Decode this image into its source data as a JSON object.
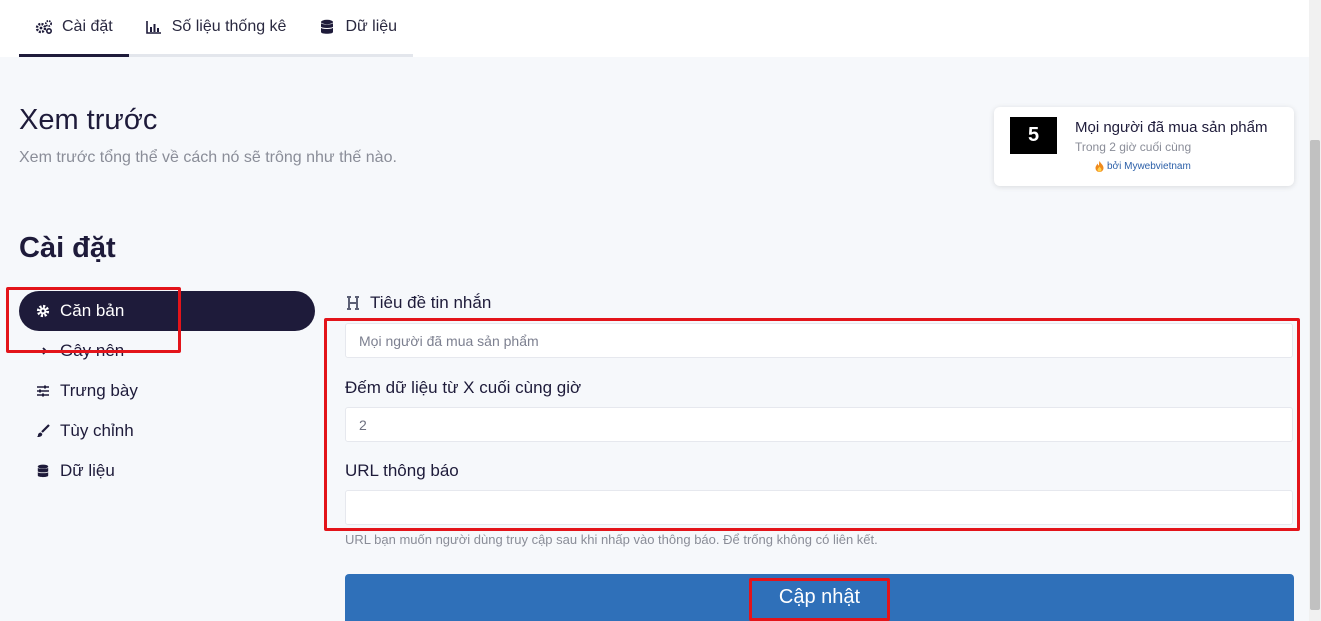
{
  "tabs": [
    {
      "label": "Cài đặt",
      "icon": "gears-icon",
      "active": true
    },
    {
      "label": "Số liệu thống kê",
      "icon": "bar-chart-icon"
    },
    {
      "label": "Dữ liệu",
      "icon": "database-icon"
    }
  ],
  "preview": {
    "title": "Xem trước",
    "description": "Xem trước tổng thể về cách nó sẽ trông như thế nào."
  },
  "notification": {
    "count": "5",
    "title": "Mọi người đã mua sản phẩm",
    "subtitle": "Trong 2 giờ cuối cùng",
    "by": "bởi Mywebvietnam",
    "by_icon": "fire-icon"
  },
  "settings": {
    "title": "Cài đặt",
    "menu": [
      {
        "label": "Căn bản",
        "icon": "gear-icon",
        "active": true
      },
      {
        "label": "Gây nên",
        "icon": "trigger-icon"
      },
      {
        "label": "Trưng bày",
        "icon": "sliders-icon"
      },
      {
        "label": "Tùy chỉnh",
        "icon": "brush-icon"
      },
      {
        "label": "Dữ liệu",
        "icon": "database-icon"
      }
    ]
  },
  "form": {
    "message_title_label": "Tiêu đề tin nhắn",
    "message_title_placeholder": "Mọi người đã mua sản phẩm",
    "count_label": "Đếm dữ liệu từ X cuối cùng giờ",
    "count_value": "2",
    "url_label": "URL thông báo",
    "url_value": "",
    "url_hint": "URL bạn muốn người dùng truy cập sau khi nhấp vào thông báo. Để trống không có liên kết.",
    "submit_label": "Cập nhật"
  },
  "colors": {
    "accent_dark": "#1e1b3a",
    "button_blue": "#2f70b9",
    "highlight_red": "#e3141a"
  }
}
